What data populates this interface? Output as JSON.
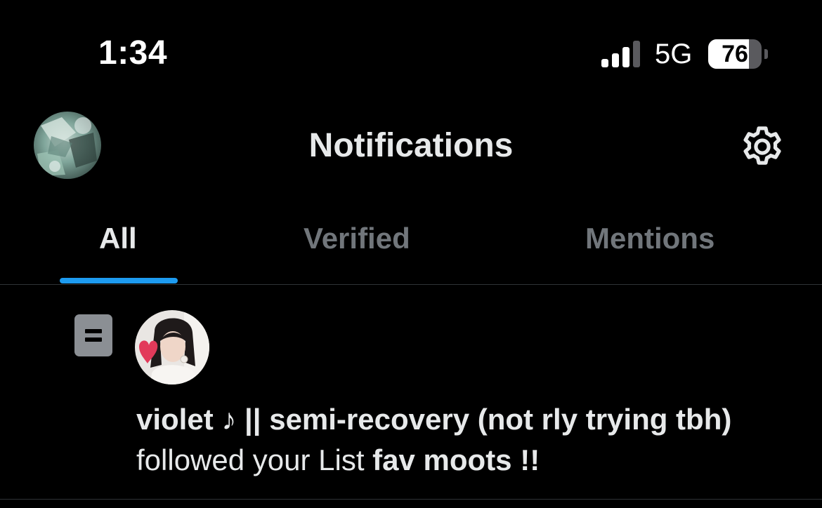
{
  "status_bar": {
    "time": "1:34",
    "network": "5G",
    "battery_level": "76",
    "signal_bars_active": 3,
    "signal_bars_total": 4
  },
  "header": {
    "title": "Notifications",
    "avatar_icon": "profile-avatar",
    "settings_icon": "gear-icon"
  },
  "tabs": [
    {
      "label": "All",
      "active": true
    },
    {
      "label": "Verified",
      "active": false
    },
    {
      "label": "Mentions",
      "active": false
    }
  ],
  "notification": {
    "icon": "list-icon",
    "user_name": "violet ♪ || semi-recovery (not rly trying tbh)",
    "action_text": "followed your List ",
    "list_name": "fav moots !!"
  },
  "colors": {
    "background": "#000000",
    "accent": "#1d9bf0",
    "text_primary": "#e7e9ea",
    "text_secondary": "#71767b",
    "divider": "#2f3336"
  }
}
